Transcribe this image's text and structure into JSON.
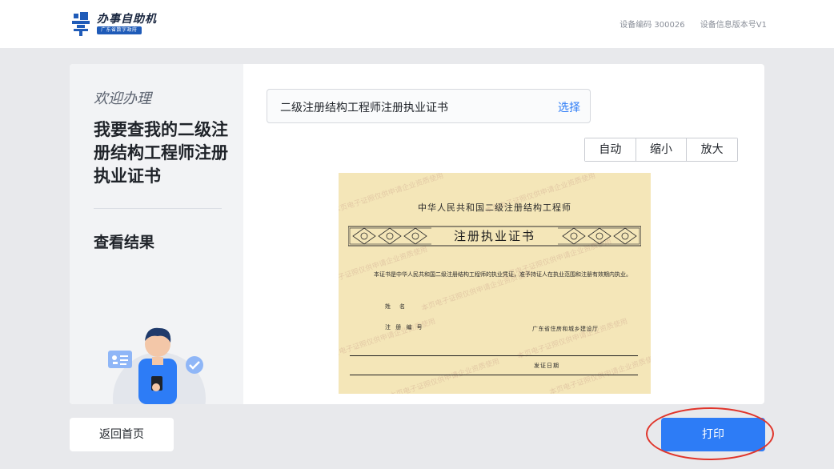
{
  "header": {
    "app_title": "办事自助机",
    "app_subtitle": "广东省数字政府",
    "device_code": "设备编码 300026",
    "device_version": "设备信息版本号V1"
  },
  "sidebar": {
    "welcome": "欢迎办理",
    "query_title": "我要查我的二级注册结构工程师注册执业证书",
    "result_label": "查看结果"
  },
  "main": {
    "certificate_select": {
      "value": "二级注册结构工程师注册执业证书",
      "action": "选择"
    },
    "zoom_buttons": [
      "自动",
      "缩小",
      "放大"
    ]
  },
  "certificate": {
    "header": "中华人民共和国二级注册结构工程师",
    "name": "注册执业证书",
    "body": "本证书是中华人民共和国二级注册结构工程师的执业凭证，准予持证人在执业范围和注册有效期内执业。",
    "name_field": "姓　名",
    "reg_number_field": "注 册 编 号",
    "issuer": "广东省住房和城乡建设厅",
    "issue_date_field": "发证日期",
    "watermark": "本页电子证照仅供申请企业资质使用"
  },
  "footer": {
    "home_label": "返回首页",
    "print_label": "打印"
  },
  "colors": {
    "accent": "#2d7cf6",
    "highlight": "#e0352b",
    "certificate_bg": "#f4e6b8"
  }
}
